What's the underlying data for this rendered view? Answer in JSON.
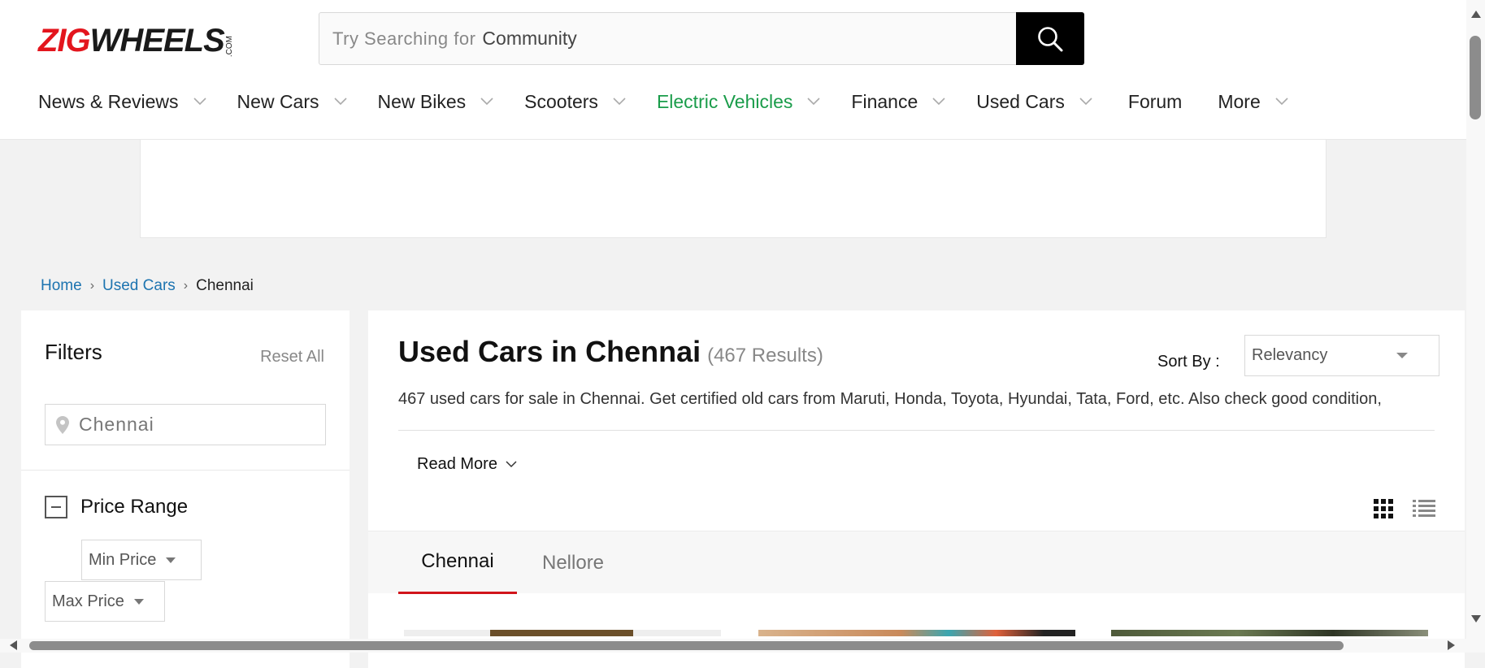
{
  "header": {
    "logo": {
      "part1": "ZIG",
      "part2": "WHEELS",
      "suffix": ".COM"
    },
    "search": {
      "placeholder": "Try Searching for",
      "value": "Community"
    },
    "nav": [
      {
        "label": "News & Reviews",
        "has_dropdown": true,
        "color": "#222222"
      },
      {
        "label": "New Cars",
        "has_dropdown": true,
        "color": "#222222"
      },
      {
        "label": "New Bikes",
        "has_dropdown": true,
        "color": "#222222"
      },
      {
        "label": "Scooters",
        "has_dropdown": true,
        "color": "#222222"
      },
      {
        "label": "Electric Vehicles",
        "has_dropdown": true,
        "color": "#1a9c4a"
      },
      {
        "label": "Finance",
        "has_dropdown": true,
        "color": "#222222"
      },
      {
        "label": "Used Cars",
        "has_dropdown": true,
        "color": "#222222"
      },
      {
        "label": "Forum",
        "has_dropdown": false,
        "color": "#222222"
      },
      {
        "label": "More",
        "has_dropdown": true,
        "color": "#222222"
      }
    ]
  },
  "breadcrumb": {
    "home": "Home",
    "used_cars": "Used Cars",
    "current": "Chennai"
  },
  "filters": {
    "title": "Filters",
    "reset": "Reset All",
    "location": "Chennai",
    "price_range": {
      "label": "Price Range",
      "min": "Min Price",
      "max": "Max Price"
    }
  },
  "main": {
    "title": "Used Cars in Chennai",
    "count": "(467 Results)",
    "sort_label": "Sort By :",
    "sort_value": "Relevancy",
    "description": "467 used cars for sale in Chennai. Get certified old cars from Maruti, Honda, Toyota, Hyundai, Tata, Ford, etc. Also check good condition,",
    "read_more": "Read More",
    "tabs": [
      {
        "label": "Chennai",
        "active": true
      },
      {
        "label": "Nellore",
        "active": false
      }
    ]
  },
  "colors": {
    "brand_red": "#e3151d",
    "link_blue": "#1d74b0",
    "ev_green": "#1a9c4a",
    "tab_underline": "#d1151b"
  }
}
